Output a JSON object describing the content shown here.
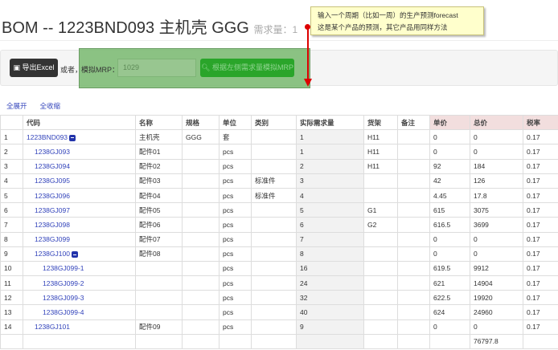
{
  "header": {
    "title": "BOM -- 1223BND093 主机壳 GGG",
    "demand_label": "需求量：1"
  },
  "toolbar": {
    "export_label": "导出Excel",
    "or_label": "或者，",
    "mrp_label": "模拟MRP：",
    "mrp_input_value": "1029",
    "mrp_button_label": "根据左侧需求量模拟MRP"
  },
  "note": {
    "line1": "输入一个周期（比如一周）的生产预测forecast",
    "line2": "这是某个产品的预测，其它产品用同样方法"
  },
  "links": {
    "expand_all": "全展开",
    "collapse_all": "全收缩"
  },
  "table": {
    "headers": [
      "",
      "代码",
      "名称",
      "规格",
      "单位",
      "类别",
      "实际需求量",
      "货架",
      "备注",
      "单价",
      "总价",
      "税率"
    ],
    "rows": [
      {
        "n": "1",
        "code": "1223BND093",
        "level": 0,
        "toggle": true,
        "name": "主机壳",
        "spec": "GGG",
        "unit": "套",
        "cat": "",
        "qty": "1",
        "shelf": "H11",
        "note": "",
        "price": "0",
        "total": "0",
        "tax": "0.17"
      },
      {
        "n": "2",
        "code": "1238GJ093",
        "level": 1,
        "toggle": false,
        "name": "配件01",
        "spec": "",
        "unit": "pcs",
        "cat": "",
        "qty": "1",
        "shelf": "H11",
        "note": "",
        "price": "0",
        "total": "0",
        "tax": "0.17"
      },
      {
        "n": "3",
        "code": "1238GJ094",
        "level": 1,
        "toggle": false,
        "name": "配件02",
        "spec": "",
        "unit": "pcs",
        "cat": "",
        "qty": "2",
        "shelf": "H11",
        "note": "",
        "price": "92",
        "total": "184",
        "tax": "0.17"
      },
      {
        "n": "4",
        "code": "1238GJ095",
        "level": 1,
        "toggle": false,
        "name": "配件03",
        "spec": "",
        "unit": "pcs",
        "cat": "标准件",
        "qty": "3",
        "shelf": "",
        "note": "",
        "price": "42",
        "total": "126",
        "tax": "0.17"
      },
      {
        "n": "5",
        "code": "1238GJ096",
        "level": 1,
        "toggle": false,
        "name": "配件04",
        "spec": "",
        "unit": "pcs",
        "cat": "标准件",
        "qty": "4",
        "shelf": "",
        "note": "",
        "price": "4.45",
        "total": "17.8",
        "tax": "0.17"
      },
      {
        "n": "6",
        "code": "1238GJ097",
        "level": 1,
        "toggle": false,
        "name": "配件05",
        "spec": "",
        "unit": "pcs",
        "cat": "",
        "qty": "5",
        "shelf": "G1",
        "note": "",
        "price": "615",
        "total": "3075",
        "tax": "0.17"
      },
      {
        "n": "7",
        "code": "1238GJ098",
        "level": 1,
        "toggle": false,
        "name": "配件06",
        "spec": "",
        "unit": "pcs",
        "cat": "",
        "qty": "6",
        "shelf": "G2",
        "note": "",
        "price": "616.5",
        "total": "3699",
        "tax": "0.17"
      },
      {
        "n": "8",
        "code": "1238GJ099",
        "level": 1,
        "toggle": false,
        "name": "配件07",
        "spec": "",
        "unit": "pcs",
        "cat": "",
        "qty": "7",
        "shelf": "",
        "note": "",
        "price": "0",
        "total": "0",
        "tax": "0.17"
      },
      {
        "n": "9",
        "code": "1238GJ100",
        "level": 1,
        "toggle": true,
        "name": "配件08",
        "spec": "",
        "unit": "pcs",
        "cat": "",
        "qty": "8",
        "shelf": "",
        "note": "",
        "price": "0",
        "total": "0",
        "tax": "0.17"
      },
      {
        "n": "10",
        "code": "1238GJ099-1",
        "level": 2,
        "toggle": false,
        "name": "",
        "spec": "",
        "unit": "pcs",
        "cat": "",
        "qty": "16",
        "shelf": "",
        "note": "",
        "price": "619.5",
        "total": "9912",
        "tax": "0.17"
      },
      {
        "n": "11",
        "code": "1238GJ099-2",
        "level": 2,
        "toggle": false,
        "name": "",
        "spec": "",
        "unit": "pcs",
        "cat": "",
        "qty": "24",
        "shelf": "",
        "note": "",
        "price": "621",
        "total": "14904",
        "tax": "0.17"
      },
      {
        "n": "12",
        "code": "1238GJ099-3",
        "level": 2,
        "toggle": false,
        "name": "",
        "spec": "",
        "unit": "pcs",
        "cat": "",
        "qty": "32",
        "shelf": "",
        "note": "",
        "price": "622.5",
        "total": "19920",
        "tax": "0.17"
      },
      {
        "n": "13",
        "code": "1238GJ099-4",
        "level": 2,
        "toggle": false,
        "name": "",
        "spec": "",
        "unit": "pcs",
        "cat": "",
        "qty": "40",
        "shelf": "",
        "note": "",
        "price": "624",
        "total": "24960",
        "tax": "0.17"
      },
      {
        "n": "14",
        "code": "1238GJ101",
        "level": 1,
        "toggle": false,
        "name": "配件09",
        "spec": "",
        "unit": "pcs",
        "cat": "",
        "qty": "9",
        "shelf": "",
        "note": "",
        "price": "0",
        "total": "0",
        "tax": "0.17"
      }
    ],
    "grand_total": "76797.8"
  }
}
